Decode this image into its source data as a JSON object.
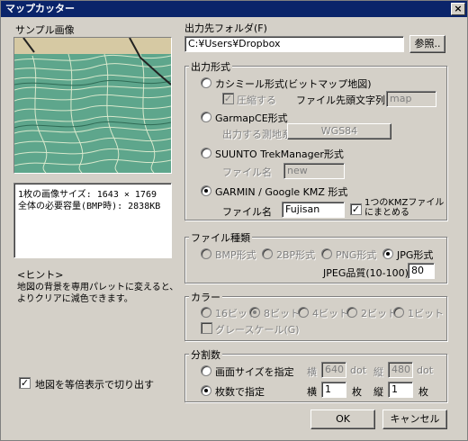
{
  "window": {
    "title": "マップカッター",
    "close_label": "×"
  },
  "sample": {
    "label": "サンプル画像",
    "info_line1": "1枚の画像サイズ: 1643 × 1769",
    "info_line2": "全体の必要容量(BMP時): 2838KB",
    "hint_title": "<ヒント>",
    "hint_line1": "地図の背景を専用パレットに変えると、",
    "hint_line2": "よりクリアに減色できます。",
    "equal_scale_checked": true,
    "equal_scale_label": "地図を等倍表示で切り出す"
  },
  "output_folder": {
    "label": "出力先フォルダ(F)",
    "value": "C:¥Users¥Dropbox",
    "browse_label": "参照.."
  },
  "output_format": {
    "title": "出力形式",
    "kashmir_label": "カシミール形式(ビットマップ地図)",
    "compress_label": "圧縮する",
    "prefix_label": "ファイル先頭文字列",
    "prefix_value": "map",
    "garmapce_label": "GarmapCE形式",
    "datum_label": "出力する測地系",
    "datum_value": "WGS84",
    "suunto_label": "SUUNTO TrekManager形式",
    "suunto_file_label": "ファイル名",
    "suunto_file_value": "new",
    "garmin_label": "GARMIN / Google KMZ 形式",
    "garmin_file_label": "ファイル名",
    "garmin_file_value": "Fujisan",
    "kmz_merge_checked": true,
    "kmz_merge_label_line1": "1つのKMZファイル",
    "kmz_merge_label_line2": "にまとめる",
    "selected": "garmin"
  },
  "file_type": {
    "title": "ファイル種類",
    "bmp": "BMP形式",
    "2bp": "2BP形式",
    "png": "PNG形式",
    "jpg": "JPG形式",
    "selected": "jpg",
    "quality_label": "JPEG品質(10-100)",
    "quality_value": "80"
  },
  "color": {
    "title": "カラー",
    "bit16": "16ビット",
    "bit8": "8ビット",
    "bit4": "4ビット",
    "bit2": "2ビット",
    "bit1": "1ビット",
    "selected": "bit8",
    "grayscale_label": "グレースケール(G)"
  },
  "split": {
    "title": "分割数",
    "screen_size_label": "画面サイズを指定",
    "width_label": "横",
    "width_value": "640",
    "height_label": "縦",
    "height_value": "480",
    "dot_label": "dot",
    "count_label": "枚数で指定",
    "cols_label": "横",
    "cols_value": "1",
    "rows_label": "縦",
    "rows_value": "1",
    "sheet_label": "枚",
    "selected": "count"
  },
  "buttons": {
    "ok": "OK",
    "cancel": "キャンセル"
  }
}
